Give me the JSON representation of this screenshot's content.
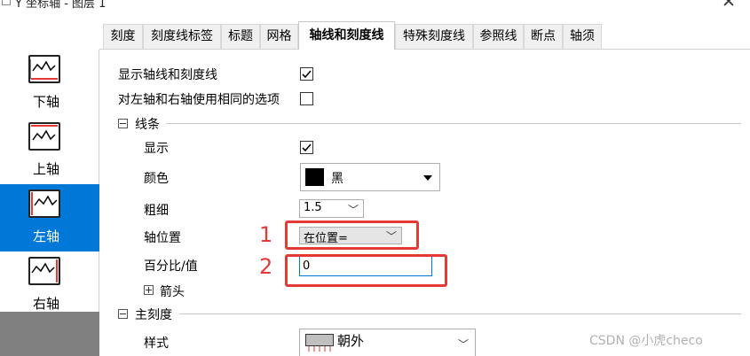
{
  "window": {
    "title": "Y 坐标轴 - 图层 1",
    "close_symbol": "✕"
  },
  "tabs": [
    {
      "label": "刻度"
    },
    {
      "label": "刻度线标签"
    },
    {
      "label": "标题"
    },
    {
      "label": "网格"
    },
    {
      "label": "轴线和刻度线",
      "active": true
    },
    {
      "label": "特殊刻度线"
    },
    {
      "label": "参照线"
    },
    {
      "label": "断点"
    },
    {
      "label": "轴须"
    }
  ],
  "sidebar": {
    "items": [
      {
        "label": "下轴",
        "icon": "bottom-axis-icon"
      },
      {
        "label": "上轴",
        "icon": "top-axis-icon"
      },
      {
        "label": "左轴",
        "icon": "left-axis-icon",
        "selected": true
      },
      {
        "label": "右轴",
        "icon": "right-axis-icon"
      }
    ]
  },
  "options": {
    "show_axis_ticks": {
      "label": "显示轴线和刻度线",
      "checked": true
    },
    "same_options": {
      "label": "对左轴和右轴使用相同的选项",
      "checked": false
    }
  },
  "line_group": {
    "title": "线条",
    "show": {
      "label": "显示",
      "checked": true
    },
    "color": {
      "label": "颜色",
      "value": "黑",
      "swatch": "#000000"
    },
    "thickness": {
      "label": "粗细",
      "value": "1.5"
    },
    "axis_position": {
      "label": "轴位置",
      "value": "在位置="
    },
    "percent_value": {
      "label": "百分比/值",
      "value": "0"
    },
    "arrow": {
      "label": "箭头"
    }
  },
  "major_tick_group": {
    "title": "主刻度",
    "style": {
      "label": "样式",
      "value": "朝外"
    }
  },
  "annotations": {
    "num1": "1",
    "num2": "2",
    "color": "#e53935"
  },
  "watermark": "CSDN @小虎checo",
  "colors": {
    "accent": "#0078d7",
    "sidebar_bottom": "#808080"
  }
}
